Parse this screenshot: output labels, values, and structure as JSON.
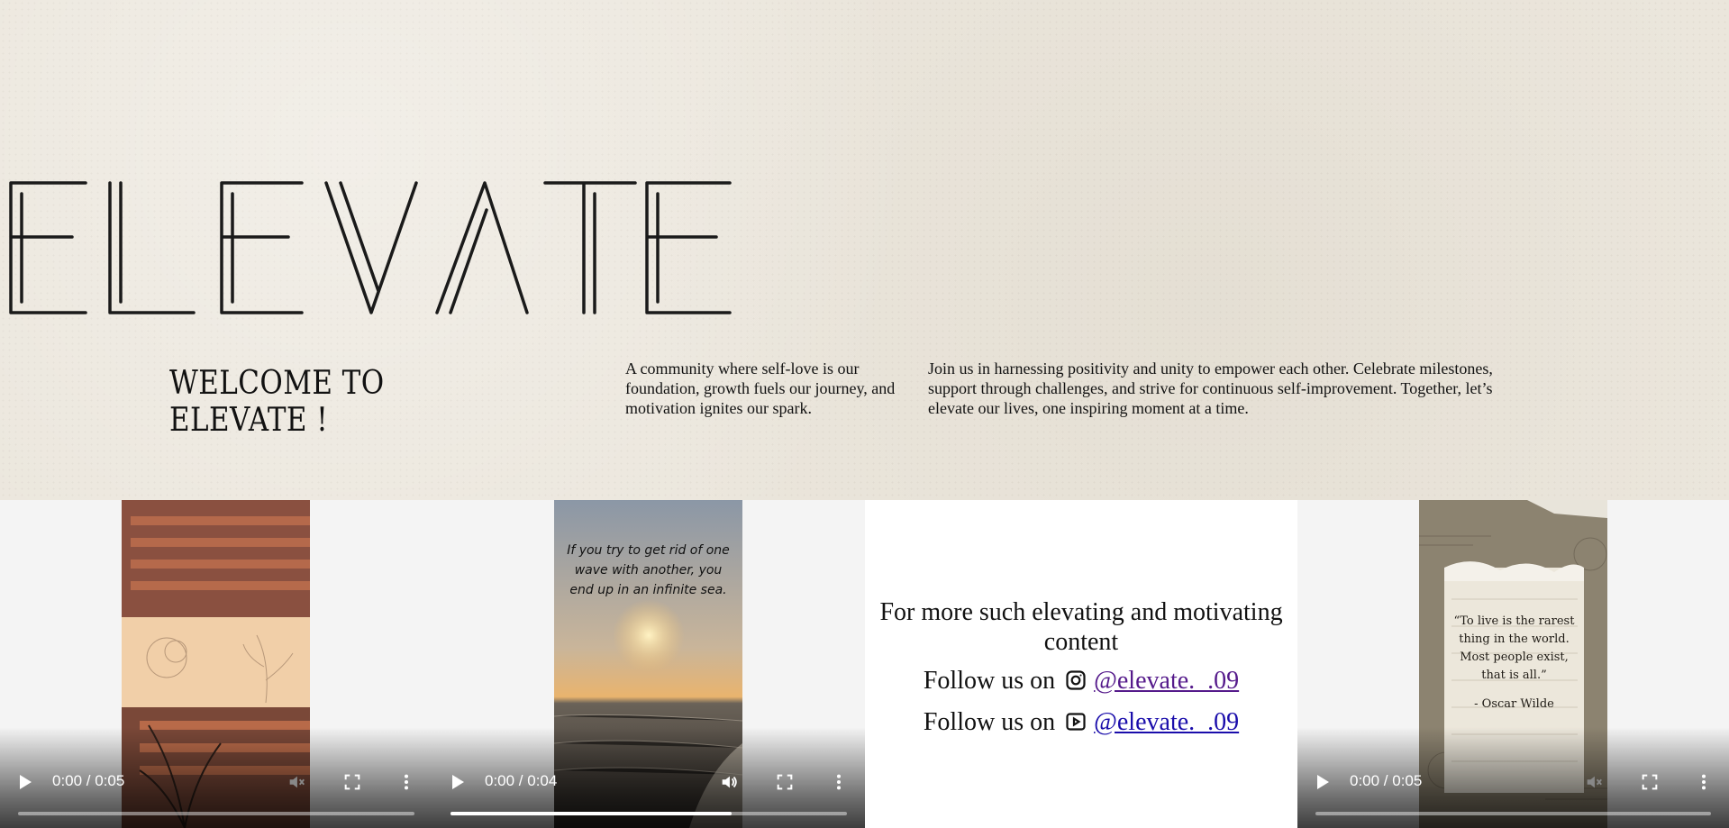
{
  "hero": {
    "logo_text": "ELEVATE",
    "welcome": "WELCOME TO ELEVATE !",
    "paragraph1": "A community where self-love is our foundation, growth fuels our journey, and motivation ignites our spark.",
    "paragraph2": "Join us in harnessing positivity and unity to empower each other. Celebrate milestones, support through challenges, and strive for continuous self-improvement. Together, let’s elevate our lives, one inspiring moment at a time."
  },
  "videos": [
    {
      "time": "0:00 / 0:05",
      "progress": 0.0,
      "muted": true
    },
    {
      "time": "0:00 / 0:04",
      "progress": 0.71,
      "muted": false,
      "quote": "If you try to get rid of one wave with another, you end up in an infinite sea."
    },
    {
      "time": "0:00 / 0:05",
      "progress": 0.0,
      "muted": true,
      "quote_lines": [
        "“To live is the rarest",
        "thing in the world.",
        "Most people exist,",
        "that is all.”",
        "- Oscar Wilde"
      ]
    }
  ],
  "follow": {
    "heading": "For more such elevating and motivating content",
    "instagram_prefix": "Follow us on",
    "instagram_handle": "@elevate._.09",
    "youtube_prefix": "Follow us on",
    "youtube_handle": "@elevate._.09"
  },
  "icons": {
    "play": "play-icon",
    "volume": "volume-icon",
    "fullscreen": "fullscreen-icon",
    "more": "more-vertical-icon",
    "instagram": "instagram-icon",
    "youtube": "youtube-icon"
  }
}
